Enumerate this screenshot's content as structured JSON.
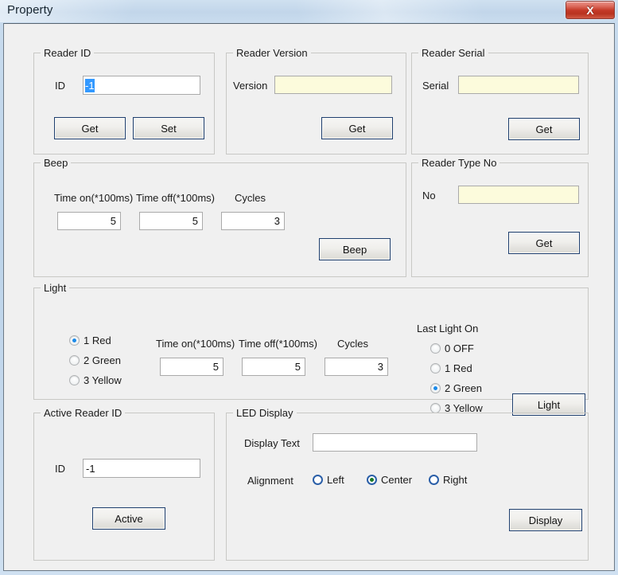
{
  "window": {
    "title": "Property",
    "close_label": "X",
    "accent_close": "#c43a28",
    "accent_selection": "#3399ff",
    "accent_button_border": "#1f3f6e",
    "readonly_field_bg": "#fcfbdc"
  },
  "reader_id": {
    "legend": "Reader ID",
    "id_label": "ID",
    "id_value": "-1",
    "get_label": "Get",
    "set_label": "Set"
  },
  "reader_version": {
    "legend": "Reader Version",
    "version_label": "Version",
    "version_value": "",
    "get_label": "Get"
  },
  "reader_serial": {
    "legend": "Reader Serial",
    "serial_label": "Serial",
    "serial_value": "",
    "get_label": "Get"
  },
  "beep": {
    "legend": "Beep",
    "time_on_label": "Time on(*100ms)",
    "time_off_label": "Time off(*100ms)",
    "cycles_label": "Cycles",
    "time_on_value": "5",
    "time_off_value": "5",
    "cycles_value": "3",
    "beep_label": "Beep"
  },
  "reader_type_no": {
    "legend": "Reader Type No",
    "no_label": "No",
    "no_value": "",
    "get_label": "Get"
  },
  "light": {
    "legend": "Light",
    "color_options": [
      {
        "label": "1 Red",
        "checked": true
      },
      {
        "label": "2 Green",
        "checked": false
      },
      {
        "label": "3 Yellow",
        "checked": false
      }
    ],
    "time_on_label": "Time on(*100ms)",
    "time_off_label": "Time off(*100ms)",
    "cycles_label": "Cycles",
    "time_on_value": "5",
    "time_off_value": "5",
    "cycles_value": "3",
    "last_light_on_label": "Last Light On",
    "last_light_options": [
      {
        "label": "0 OFF",
        "checked": false
      },
      {
        "label": "1 Red",
        "checked": false
      },
      {
        "label": "2 Green",
        "checked": true
      },
      {
        "label": "3 Yellow",
        "checked": false
      }
    ],
    "light_label": "Light"
  },
  "active_reader_id": {
    "legend": "Active Reader ID",
    "id_label": "ID",
    "id_value": "-1",
    "active_label": "Active"
  },
  "led_display": {
    "legend": "LED Display",
    "display_text_label": "Display Text",
    "display_text_value": "",
    "alignment_label": "Alignment",
    "alignment_options": [
      {
        "label": "Left",
        "checked": false
      },
      {
        "label": "Center",
        "checked": true
      },
      {
        "label": "Right",
        "checked": false
      }
    ],
    "display_label": "Display"
  }
}
